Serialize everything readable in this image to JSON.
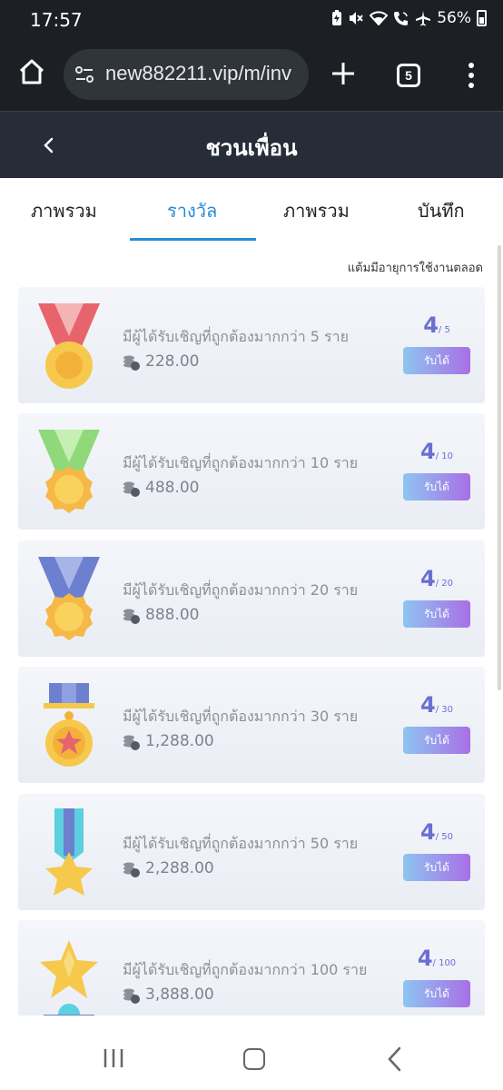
{
  "status_bar": {
    "time": "17:57",
    "battery": "56%",
    "icons": [
      "battery-saver-icon",
      "mute-icon",
      "wifi-icon",
      "wifi-calling-icon",
      "airplane-icon",
      "battery-icon"
    ]
  },
  "browser": {
    "url": "new882211.vip/m/inv",
    "tab_count": "5"
  },
  "header": {
    "title": "ชวนเพื่อน"
  },
  "tabs": [
    {
      "label": "ภาพรวม",
      "active": false
    },
    {
      "label": "รางวัล",
      "active": true
    },
    {
      "label": "ภาพรวม",
      "active": false
    },
    {
      "label": "บันทึก",
      "active": false
    }
  ],
  "note": "แต้มมีอายุการใช้งานตลอด",
  "rewards": [
    {
      "title": "มีผู้ได้รับเชิญที่ถูกต้องมากกว่า 5 ราย",
      "amount": "228.00",
      "progress": "4",
      "total": "/ 5",
      "button": "รับได้",
      "medal": "red-ribbon-medal-icon"
    },
    {
      "title": "มีผู้ได้รับเชิญที่ถูกต้องมากกว่า 10 ราย",
      "amount": "488.00",
      "progress": "4",
      "total": "/ 10",
      "button": "รับได้",
      "medal": "green-ribbon-medal-icon"
    },
    {
      "title": "มีผู้ได้รับเชิญที่ถูกต้องมากกว่า 20 ราย",
      "amount": "888.00",
      "progress": "4",
      "total": "/ 20",
      "button": "รับได้",
      "medal": "blue-ribbon-medal-icon"
    },
    {
      "title": "มีผู้ได้รับเชิญที่ถูกต้องมากกว่า 30 ราย",
      "amount": "1,288.00",
      "progress": "4",
      "total": "/ 30",
      "button": "รับได้",
      "medal": "star-medal-icon"
    },
    {
      "title": "มีผู้ได้รับเชิญที่ถูกต้องมากกว่า 50 ราย",
      "amount": "2,288.00",
      "progress": "4",
      "total": "/ 50",
      "button": "รับได้",
      "medal": "star-ribbon-medal-icon"
    },
    {
      "title": "มีผู้ได้รับเชิญที่ถูกต้องมากกว่า 100 ราย",
      "amount": "3,888.00",
      "progress": "4",
      "total": "/ 100",
      "button": "รับได้",
      "medal": "star-trophy-icon"
    }
  ],
  "colors": {
    "header_bg": "#262c38",
    "accent": "#2a8bd6",
    "progress_text": "#6a6fd1"
  }
}
